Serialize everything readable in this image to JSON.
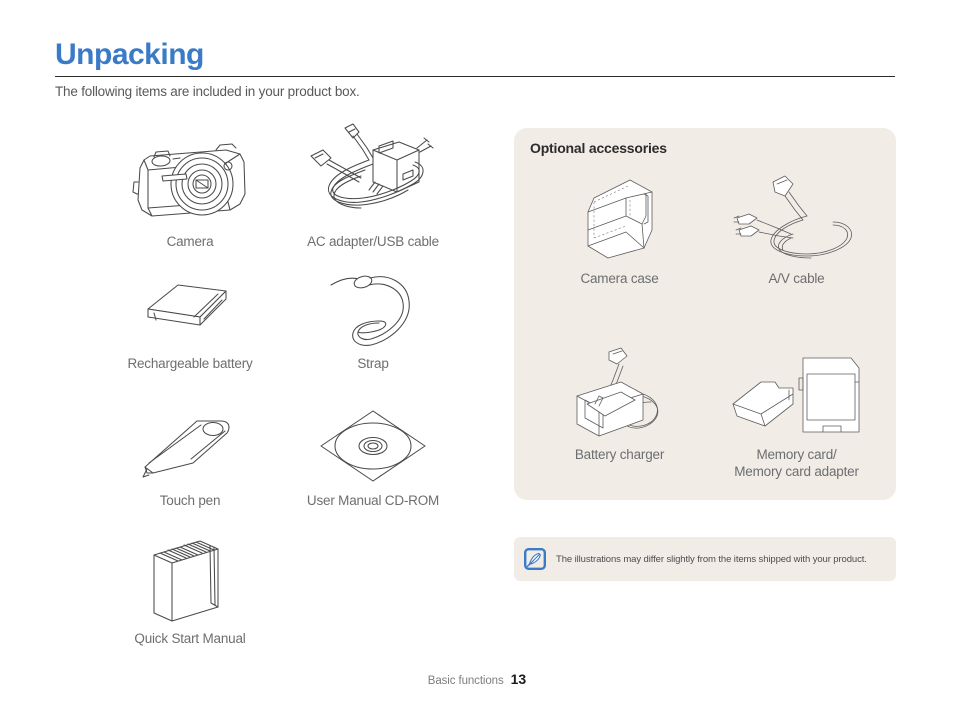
{
  "header": {
    "title": "Unpacking",
    "title_color": "#3a7bc8",
    "subtitle": "The following items are included in your product box."
  },
  "included_items": [
    {
      "label": "Camera",
      "icon": "camera-icon"
    },
    {
      "label": "AC adapter/USB cable",
      "icon": "ac-adapter-usb-cable-icon"
    },
    {
      "label": "Rechargeable battery",
      "icon": "battery-icon"
    },
    {
      "label": "Strap",
      "icon": "strap-icon"
    },
    {
      "label": "Touch pen",
      "icon": "touch-pen-icon"
    },
    {
      "label": "User Manual CD-ROM",
      "icon": "cd-rom-icon"
    },
    {
      "label": "Quick Start Manual",
      "icon": "manual-booklet-icon"
    }
  ],
  "optional_accessories": {
    "panel_title": "Optional accessories",
    "panel_color": "#f1ece6",
    "items": [
      {
        "label": "Camera case",
        "icon": "camera-case-icon"
      },
      {
        "label": "A/V cable",
        "icon": "av-cable-icon"
      },
      {
        "label": "Battery charger",
        "icon": "battery-charger-icon"
      },
      {
        "label_line1": "Memory card/",
        "label_line2": "Memory card adapter",
        "icon": "memory-card-icon"
      }
    ]
  },
  "note": {
    "icon": "note-pen-icon",
    "icon_color": "#3a7bc8",
    "text": "The illustrations may differ slightly from the items shipped with your product."
  },
  "footer": {
    "section": "Basic functions",
    "page_number": "13"
  }
}
